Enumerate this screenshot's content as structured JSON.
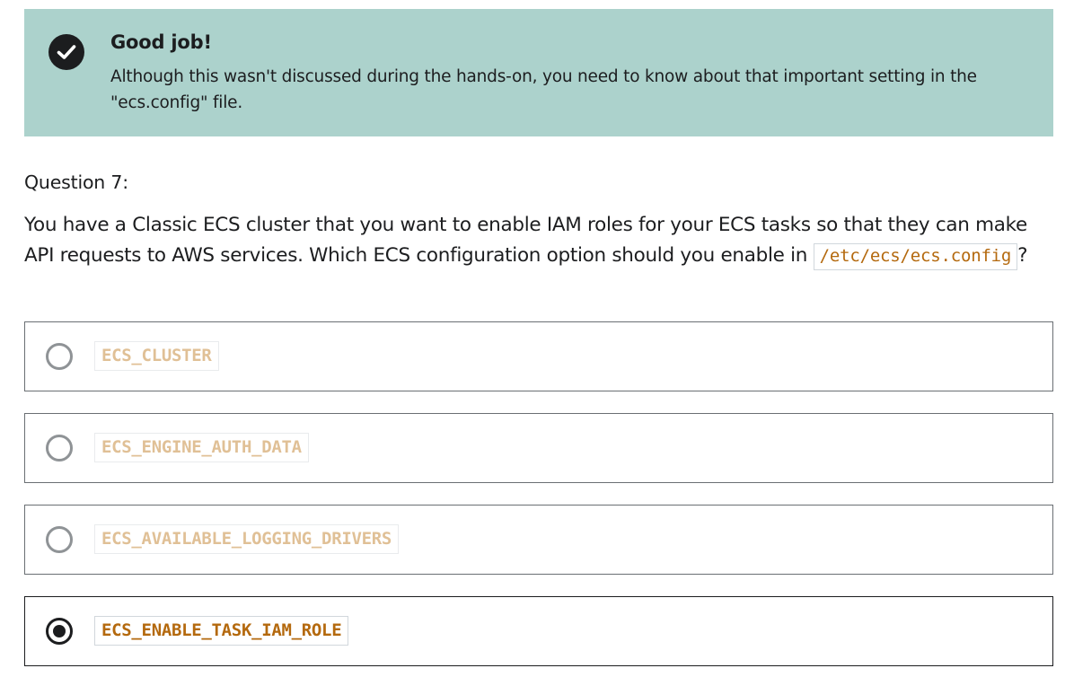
{
  "feedback": {
    "title": "Good job!",
    "message": "Although this wasn't discussed during the hands-on, you need to know about that important setting in the \"ecs.config\" file.",
    "icon": "check-circle-icon",
    "background_color": "#acd2cc"
  },
  "question": {
    "number_label": "Question 7:",
    "text": "You have a Classic ECS cluster that you want to enable IAM roles for your ECS tasks so that they can make API requests to AWS services. Which ECS configuration option should you enable in ",
    "code": "/etc/ecs/ecs.config",
    "suffix": "?"
  },
  "options": [
    {
      "label": "ECS_CLUSTER",
      "selected": false
    },
    {
      "label": "ECS_ENGINE_AUTH_DATA",
      "selected": false
    },
    {
      "label": "ECS_AVAILABLE_LOGGING_DRIVERS",
      "selected": false
    },
    {
      "label": "ECS_ENABLE_TASK_IAM_ROLE",
      "selected": true
    }
  ],
  "colors": {
    "code_text": "#b4690e",
    "code_text_faded": "#e0c096",
    "text": "#1c1d1f"
  }
}
